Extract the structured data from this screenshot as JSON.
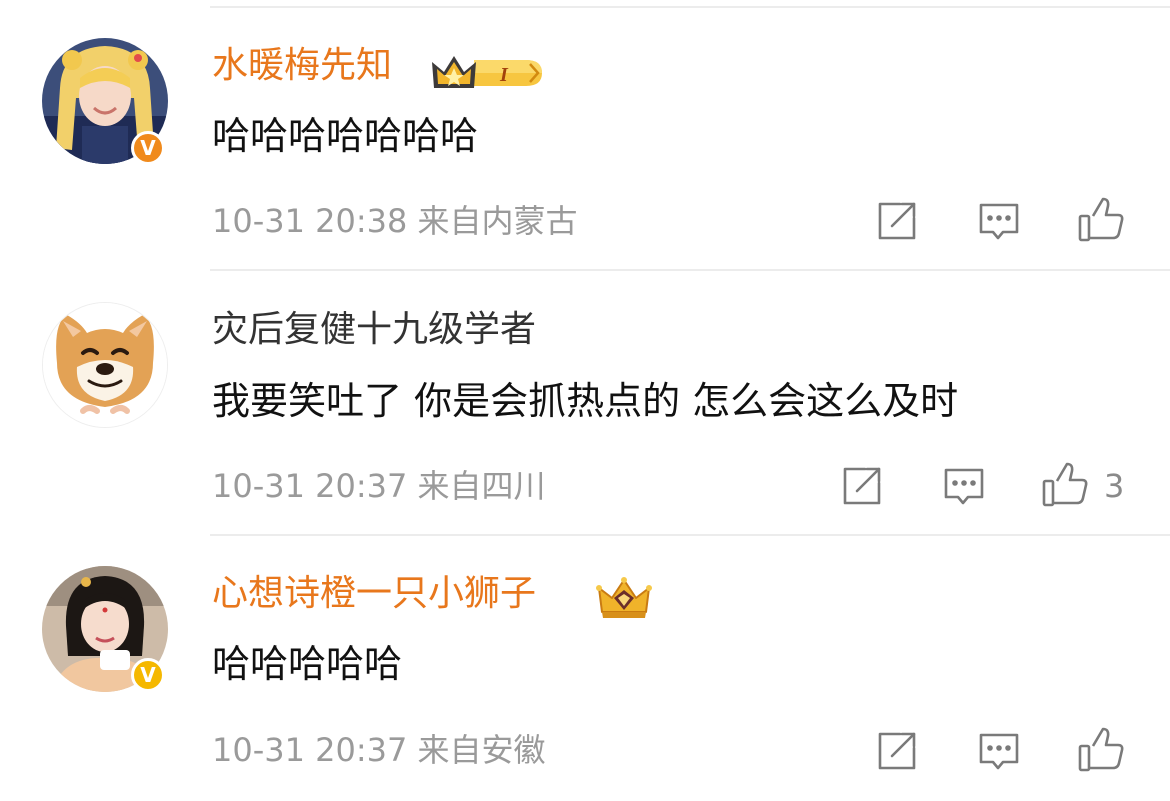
{
  "comments": [
    {
      "username": "水暖梅先知",
      "text": "哈哈哈哈哈哈哈",
      "timestamp": "10-31 20:38",
      "location": "来自内蒙古",
      "verified": true,
      "verified_badge_label": "V",
      "verified_color": "#f08a1c",
      "vip": true,
      "crown_badge": "crown-icon",
      "crown_level": "I",
      "likes": "",
      "icons": {
        "repost": "share-icon",
        "comment": "comment-icon",
        "like": "thumbs-up-icon"
      }
    },
    {
      "username": "灾后复健十九级学者",
      "text": "我要笑吐了 你是会抓热点的 怎么会这么及时",
      "timestamp": "10-31 20:37",
      "location": "来自四川",
      "verified": false,
      "vip": false,
      "likes": "3",
      "icons": {
        "repost": "share-icon",
        "comment": "comment-icon",
        "like": "thumbs-up-icon"
      }
    },
    {
      "username": "心想诗橙一只小狮子",
      "text": "哈哈哈哈哈",
      "timestamp": "10-31 20:37",
      "location": "来自安徽",
      "verified": true,
      "verified_badge_label": "V",
      "verified_color": "#f5b800",
      "vip": true,
      "crown_badge": "crown-icon",
      "likes": "",
      "icons": {
        "repost": "share-icon",
        "comment": "comment-icon",
        "like": "thumbs-up-icon"
      }
    }
  ],
  "colors": {
    "vip_name": "#e8771c",
    "normal_name": "#333333",
    "meta": "#9a9a9a",
    "divider": "#ececec"
  }
}
